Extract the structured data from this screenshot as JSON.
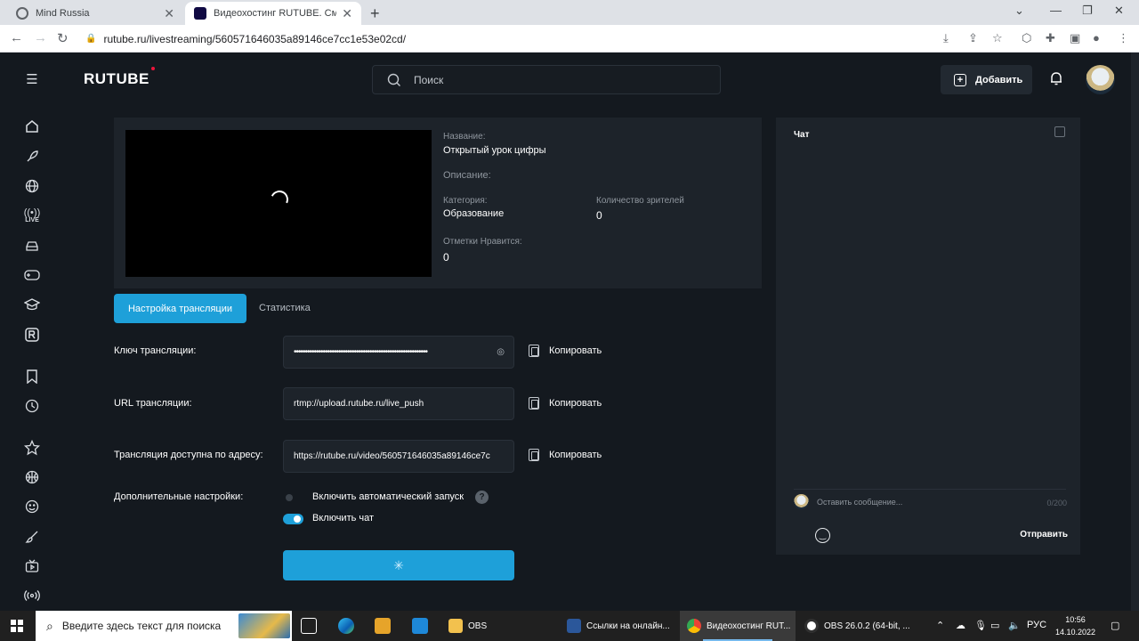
{
  "browser": {
    "tabs": [
      {
        "title": "Mind Russia",
        "active": false
      },
      {
        "title": "Видеохостинг RUTUBE. Смотри",
        "active": true
      }
    ],
    "url": "rutube.ru/livestreaming/560571646035a89146ce7cc1e53e02cd/"
  },
  "header": {
    "logo": "RUTUBE",
    "search_placeholder": "Поиск",
    "add_label": "Добавить"
  },
  "sidebar": {
    "icons": [
      "menu-icon",
      "home-icon",
      "rocket-icon",
      "globe-icon",
      "live-icon",
      "car-icon",
      "gamepad-icon",
      "education-icon",
      "rutube-r-icon",
      "bookmark-icon",
      "history-icon",
      "star-icon",
      "sport-icon",
      "smile-icon",
      "brush-icon",
      "tv-icon",
      "broadcast-icon"
    ],
    "live_text": "LIVE"
  },
  "stream_info": {
    "title_label": "Название:",
    "title_value": "Открытый урок цифры",
    "description_label": "Описание:",
    "category_label": "Категория:",
    "category_value": "Образование",
    "viewers_label": "Количество зрителей",
    "viewers_value": "0",
    "likes_label": "Отметки Нравится:",
    "likes_value": "0"
  },
  "tabs": {
    "settings": "Настройка трансляции",
    "stats": "Статистика"
  },
  "form": {
    "key_label": "Ключ трансляции:",
    "key_value": "••••••••••••••••••••••••••••••••••••••••••••••••••••••••••••",
    "url_label": "URL трансляции:",
    "url_value": "rtmp://upload.rutube.ru/live_push",
    "public_label": "Трансляция доступна по адресу:",
    "public_value": "https://rutube.ru/video/560571646035a89146ce7c",
    "copy_label": "Копировать",
    "extra_label": "Дополнительные настройки:",
    "autostart_label": "Включить автоматический запуск",
    "autostart_on": false,
    "chat_label": "Включить чат",
    "chat_on": true,
    "help_glyph": "?"
  },
  "chat": {
    "title": "Чат",
    "placeholder": "Оставить сообщение...",
    "counter": "0/200",
    "send_label": "Отправить"
  },
  "taskbar": {
    "search_placeholder": "Введите здесь текст для поиска",
    "apps": [
      {
        "label": "OBS"
      },
      {
        "label": "Ссылки на онлайн..."
      },
      {
        "label": "Видеохостинг RUT..."
      },
      {
        "label": "OBS 26.0.2 (64-bit, ..."
      }
    ],
    "lang": "РУС",
    "time": "10:56",
    "date": "14.10.2022"
  },
  "colors": {
    "accent": "#1ea0d9",
    "page_bg": "#14191f",
    "card_bg": "#1d232a",
    "logo_dot": "#ed143b"
  }
}
